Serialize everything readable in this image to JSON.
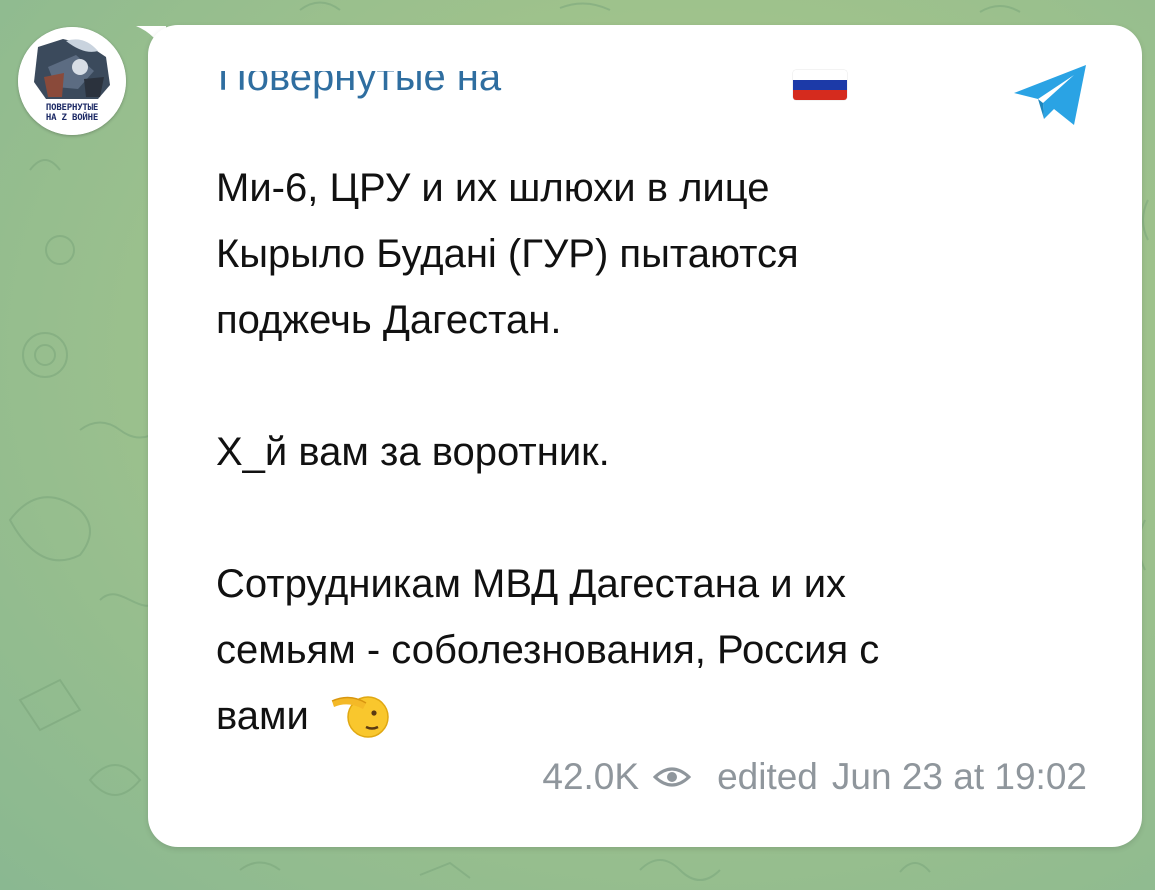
{
  "channel": {
    "avatar_caption_line1": "ПОВЕРНУТЫЕ",
    "avatar_caption_line2": "НА Z ВОЙНЕ",
    "name": "Повернутые на"
  },
  "message": {
    "line1": "Ми-6, ЦРУ и их шлюхи в лице",
    "line2": "Кырыло Будані (ГУР) пытаются",
    "line3": "поджечь Дагестан.",
    "line4": "Х_й вам за воротник.",
    "line5": "Сотрудникам МВД Дагестана и их",
    "line6": "семьям - соболезнования, Россия с",
    "line7": "вами"
  },
  "footer": {
    "views": "42.0K",
    "edited_label": "edited",
    "timestamp": "Jun 23 at 19:02"
  },
  "icons": {
    "flag": "russia-flag-icon",
    "app": "telegram-icon",
    "views": "eye-icon",
    "emoji": "saluting-face-icon"
  },
  "colors": {
    "channel_name": "#2f6ea0",
    "telegram_blue": "#2aa3e4",
    "meta_gray": "#8f969c",
    "background": "#9fc28c"
  }
}
